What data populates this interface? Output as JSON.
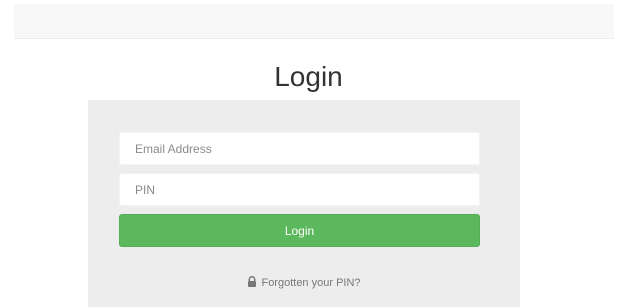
{
  "page": {
    "title": "Login"
  },
  "form": {
    "email_placeholder": "Email Address",
    "email_value": "",
    "pin_placeholder": "PIN",
    "pin_value": "",
    "login_label": "Login",
    "forgot_label": "Forgotten your PIN?",
    "forgot_icon": "lock-icon"
  },
  "colors": {
    "accent": "#5cb85c",
    "panel_background": "#ededed",
    "top_bar_background": "#f8f8f8"
  }
}
